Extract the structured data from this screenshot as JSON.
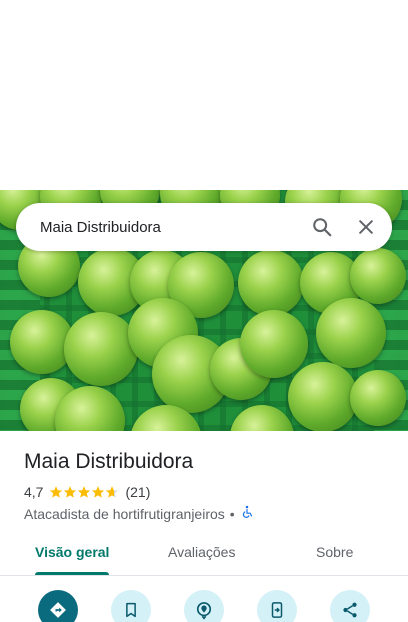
{
  "search": {
    "query": "Maia Distribuidora"
  },
  "place": {
    "name": "Maia Distribuidora",
    "rating": "4,7",
    "stars": 4.7,
    "review_count": "(21)",
    "category": "Atacadista de hortifrutigranjeiros",
    "separator": "•"
  },
  "tabs": [
    {
      "label": "Visão geral",
      "active": true
    },
    {
      "label": "Avaliações",
      "active": false
    },
    {
      "label": "Sobre",
      "active": false
    }
  ],
  "actions": [
    {
      "icon": "directions-icon"
    },
    {
      "icon": "bookmark-icon"
    },
    {
      "icon": "nearby-icon"
    },
    {
      "icon": "send-to-phone-icon"
    },
    {
      "icon": "share-icon"
    }
  ],
  "colors": {
    "accent": "#00796b",
    "primary_action": "#0a6b7f",
    "secondary_action_bg": "#d4f1f8",
    "star": "#fbbc04",
    "accessibility": "#1a73e8"
  }
}
